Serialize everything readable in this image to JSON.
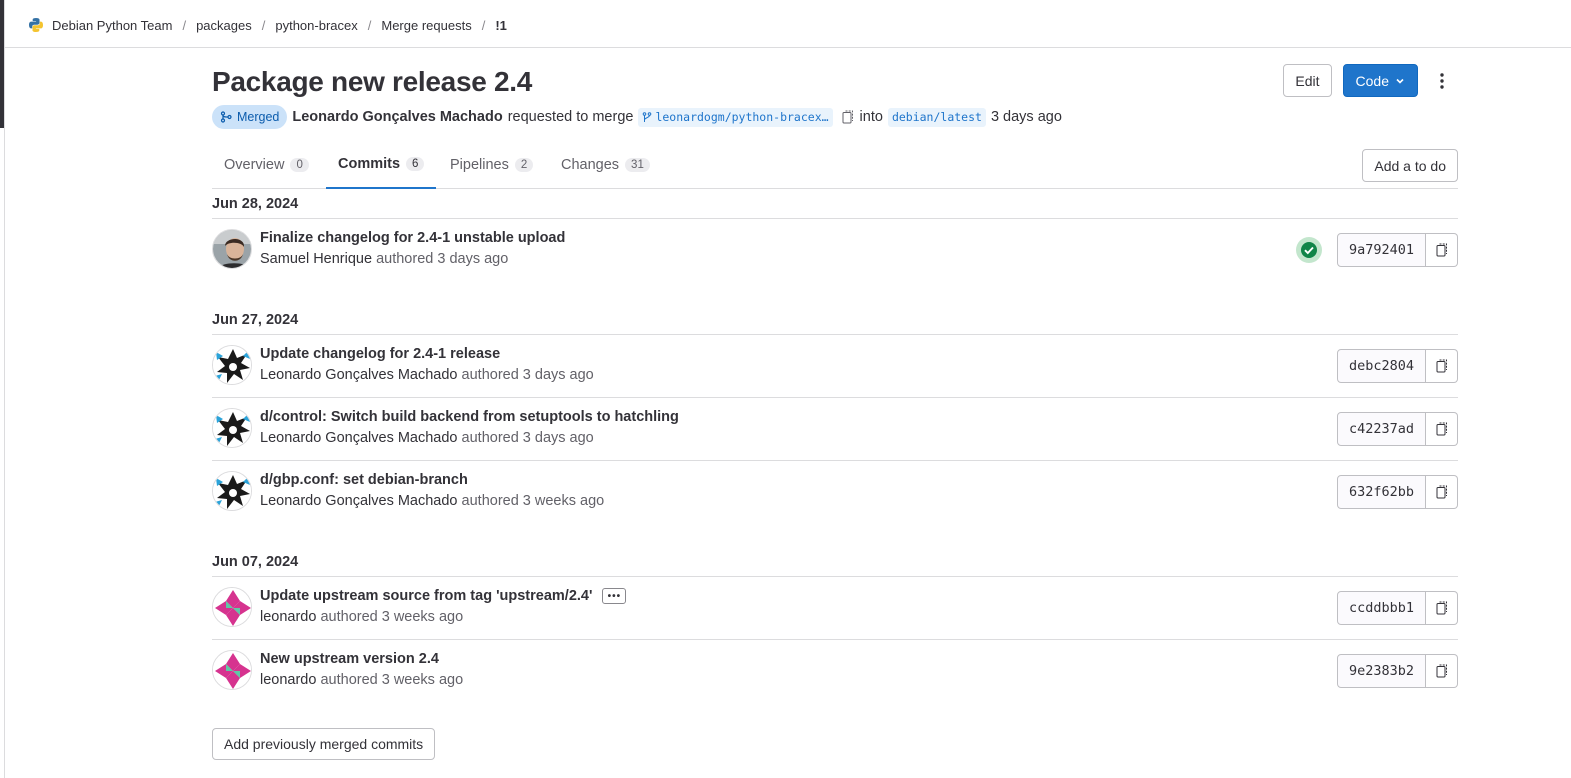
{
  "breadcrumb": {
    "items": [
      "Debian Python Team",
      "packages",
      "python-bracex",
      "Merge requests",
      "!1"
    ],
    "separator": "/"
  },
  "mr": {
    "title": "Package new release 2.4",
    "status": "Merged",
    "author": "Leonardo Gonçalves Machado",
    "requested_text": "requested to merge",
    "source_branch": "leonardogm/python-bracex…",
    "into_text": "into",
    "target_branch": "debian/latest",
    "time": "3 days ago"
  },
  "header_buttons": {
    "edit": "Edit",
    "code": "Code"
  },
  "tabs": [
    {
      "label": "Overview",
      "count": "0"
    },
    {
      "label": "Commits",
      "count": "6",
      "active": true
    },
    {
      "label": "Pipelines",
      "count": "2"
    },
    {
      "label": "Changes",
      "count": "31"
    }
  ],
  "todo_button": "Add a to do",
  "commit_groups": [
    {
      "date": "Jun 28, 2024",
      "commits": [
        {
          "title": "Finalize changelog for 2.4-1 unstable upload",
          "author": "Samuel Henrique",
          "authored": "authored 3 days ago",
          "sha": "9a792401",
          "pipeline": "passed",
          "avatar": "photo"
        }
      ]
    },
    {
      "date": "Jun 27, 2024",
      "commits": [
        {
          "title": "Update changelog for 2.4-1 release",
          "author": "Leonardo Gonçalves Machado",
          "authored": "authored 3 days ago",
          "sha": "debc2804",
          "avatar": "star"
        },
        {
          "title": "d/control: Switch build backend from setuptools to hatchling",
          "author": "Leonardo Gonçalves Machado",
          "authored": "authored 3 days ago",
          "sha": "c42237ad",
          "avatar": "star"
        },
        {
          "title": "d/gbp.conf: set debian-branch",
          "author": "Leonardo Gonçalves Machado",
          "authored": "authored 3 weeks ago",
          "sha": "632f62bb",
          "avatar": "star"
        }
      ]
    },
    {
      "date": "Jun 07, 2024",
      "commits": [
        {
          "title": "Update upstream source from tag 'upstream/2.4'",
          "author": "leonardo",
          "authored": "authored 3 weeks ago",
          "sha": "ccddbbb1",
          "avatar": "identicon",
          "has_description": true
        },
        {
          "title": "New upstream version 2.4",
          "author": "leonardo",
          "authored": "authored 3 weeks ago",
          "sha": "9e2383b2",
          "avatar": "identicon"
        }
      ]
    }
  ],
  "add_previous_button": "Add previously merged commits",
  "colors": {
    "accent": "#1f75cb",
    "merged_bg": "#cbe2f9",
    "success": "#108548"
  }
}
